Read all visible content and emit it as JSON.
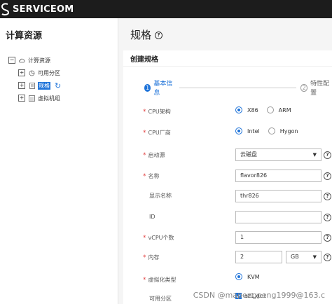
{
  "app": {
    "brand": "SERVICEOM",
    "brand_color": "#ffffff",
    "topbar_color": "#1c1c1c"
  },
  "sidebar": {
    "title": "计算资源",
    "tree": [
      {
        "label": "计算资源",
        "toggle": "−",
        "icon": "cloud-icon"
      },
      {
        "label": "可用分区",
        "toggle": "+",
        "icon": "zone-icon"
      },
      {
        "label": "规格",
        "toggle": "+",
        "icon": "spec-icon",
        "selected": true
      },
      {
        "label": "虚拟机组",
        "toggle": "+",
        "icon": "vm-group-icon"
      }
    ]
  },
  "main": {
    "page_title": "规格",
    "card_title": "创建规格",
    "steps": [
      {
        "num": "1",
        "label": "基本信息"
      },
      {
        "num": "2",
        "label": "特性配置"
      }
    ],
    "form": {
      "cpu_arch": {
        "label": "CPU架构",
        "options": [
          "X86",
          "ARM"
        ],
        "selected": "X86"
      },
      "cpu_vendor": {
        "label": "CPU厂商",
        "options": [
          "Intel",
          "Hygon"
        ],
        "selected": "Intel"
      },
      "boot_source": {
        "label": "启动源",
        "value": "云磁盘"
      },
      "name": {
        "label": "名称",
        "value": "flavor826"
      },
      "display_name": {
        "label": "显示名称",
        "value": "thr826"
      },
      "id": {
        "label": "ID",
        "value": ""
      },
      "vcpu": {
        "label": "vCPU个数",
        "value": "1"
      },
      "memory": {
        "label": "内存",
        "value": "2",
        "unit": "GB"
      },
      "virt_type": {
        "label": "虚拟化类型",
        "options": [
          "KVM"
        ],
        "selected": "KVM"
      },
      "az": {
        "label": "可用分区",
        "value": "az1.dc1"
      }
    }
  },
  "watermark": "CSDN @mapengpeng1999@163.c",
  "colors": {
    "accent": "#1e73d9",
    "required": "#e34545"
  }
}
